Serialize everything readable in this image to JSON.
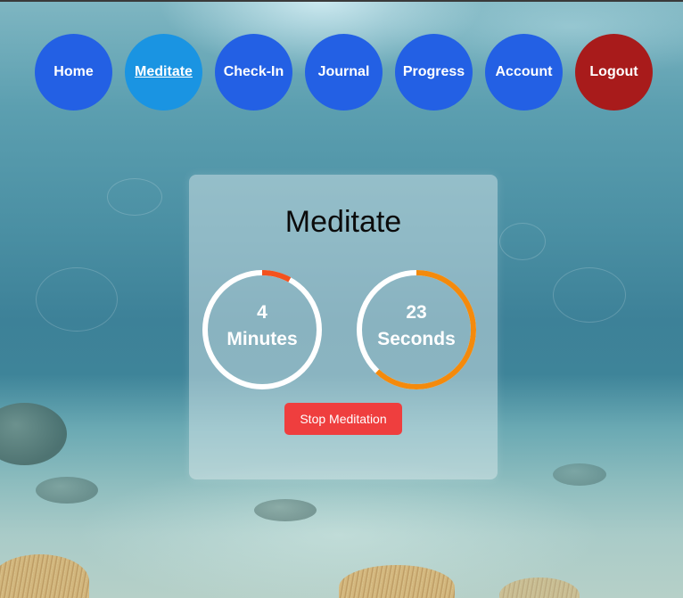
{
  "nav": {
    "items": [
      {
        "label": "Home"
      },
      {
        "label": "Meditate"
      },
      {
        "label": "Check-In"
      },
      {
        "label": "Journal"
      },
      {
        "label": "Progress"
      },
      {
        "label": "Account"
      },
      {
        "label": "Logout"
      }
    ],
    "active_index": 1,
    "colors": {
      "default": "#2360e4",
      "active": "#1a94e2",
      "logout": "#a81b1b"
    }
  },
  "meditate": {
    "title": "Meditate",
    "minutes": {
      "value": "4",
      "unit": "Minutes",
      "progress": 0.08,
      "color": "#f4521e"
    },
    "seconds": {
      "value": "23",
      "unit": "Seconds",
      "progress": 0.62,
      "color": "#f48a0c"
    },
    "stop_label": "Stop Meditation",
    "stop_color": "#ef3e3e"
  }
}
